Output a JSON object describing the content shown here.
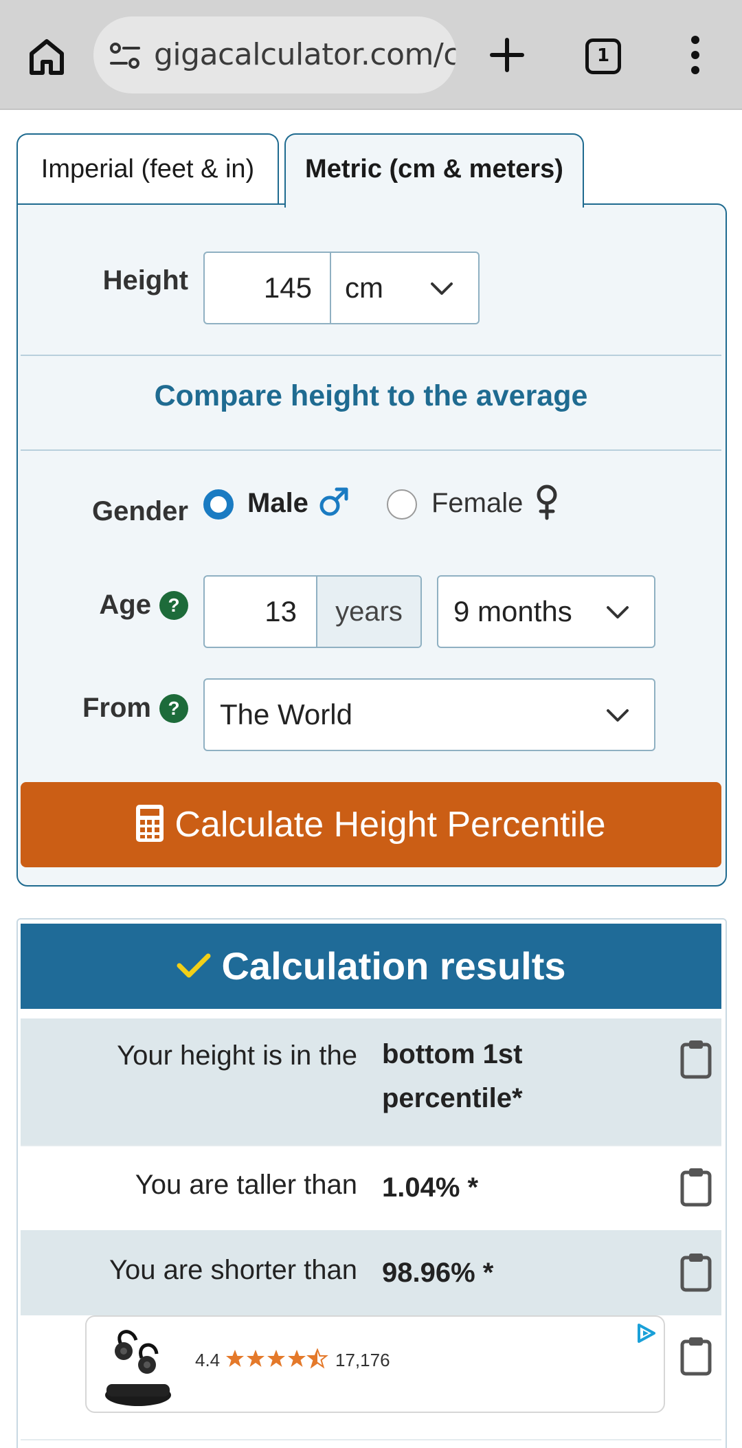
{
  "browser": {
    "url": "gigacalculator.com/c",
    "tab_count": "1"
  },
  "tabs": [
    {
      "label": "Imperial (feet & in)",
      "active": false
    },
    {
      "label": "Metric (cm & meters)",
      "active": true
    }
  ],
  "form": {
    "height_label": "Height",
    "height_value": "145",
    "height_unit": "cm",
    "compare_link": "Compare height to the average",
    "gender_label": "Gender",
    "gender_options": [
      {
        "label": "Male",
        "icon": "male-symbol-icon",
        "selected": true
      },
      {
        "label": "Female",
        "icon": "female-symbol-icon",
        "selected": false
      }
    ],
    "age_label": "Age",
    "age_years_value": "13",
    "age_years_unit": "years",
    "age_months_value": "9 months",
    "from_label": "From",
    "from_value": "The World",
    "help_symbol": "?",
    "calculate_button": "Calculate Height Percentile"
  },
  "results": {
    "title": "Calculation results",
    "rows": [
      {
        "label": "Your height is in the",
        "value_line1": "bottom 1st",
        "value_line2": "percentile*"
      },
      {
        "label": "You are taller than",
        "value": "1.04% *"
      },
      {
        "label": "You are shorter than",
        "value": "98.96% *"
      }
    ]
  },
  "ad": {
    "rating": "4.4",
    "stars": 4.5,
    "review_count": "17,176"
  },
  "colors": {
    "accent_blue": "#1f6b98",
    "link_blue": "#1f6b91",
    "button_orange": "#cb5e15",
    "help_green": "#1d6b3a",
    "check_yellow": "#f2cf17",
    "star_orange": "#e4792a"
  }
}
